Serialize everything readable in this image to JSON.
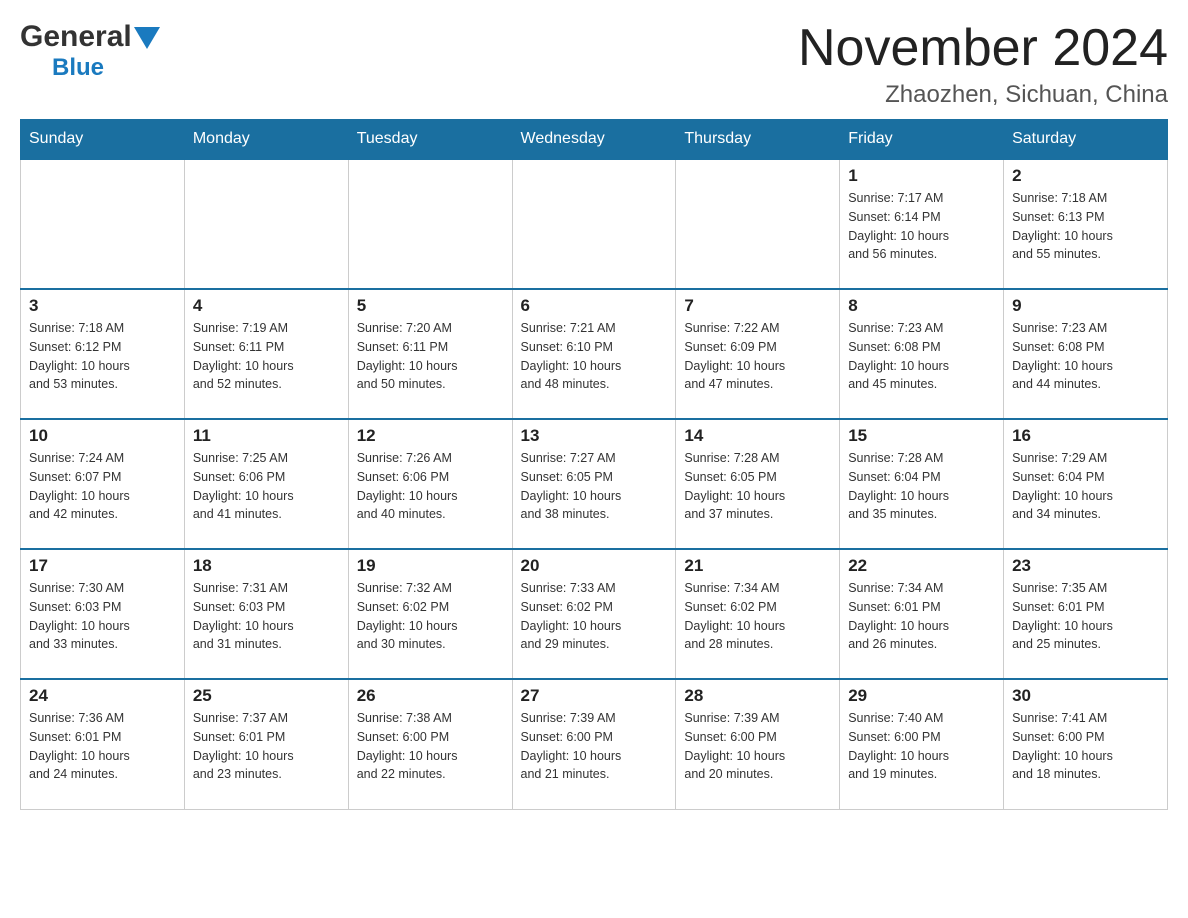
{
  "logo": {
    "general": "General",
    "blue": "Blue"
  },
  "header": {
    "month_year": "November 2024",
    "location": "Zhaozhen, Sichuan, China"
  },
  "days_of_week": [
    "Sunday",
    "Monday",
    "Tuesday",
    "Wednesday",
    "Thursday",
    "Friday",
    "Saturday"
  ],
  "weeks": [
    [
      {
        "day": "",
        "info": ""
      },
      {
        "day": "",
        "info": ""
      },
      {
        "day": "",
        "info": ""
      },
      {
        "day": "",
        "info": ""
      },
      {
        "day": "",
        "info": ""
      },
      {
        "day": "1",
        "info": "Sunrise: 7:17 AM\nSunset: 6:14 PM\nDaylight: 10 hours\nand 56 minutes."
      },
      {
        "day": "2",
        "info": "Sunrise: 7:18 AM\nSunset: 6:13 PM\nDaylight: 10 hours\nand 55 minutes."
      }
    ],
    [
      {
        "day": "3",
        "info": "Sunrise: 7:18 AM\nSunset: 6:12 PM\nDaylight: 10 hours\nand 53 minutes."
      },
      {
        "day": "4",
        "info": "Sunrise: 7:19 AM\nSunset: 6:11 PM\nDaylight: 10 hours\nand 52 minutes."
      },
      {
        "day": "5",
        "info": "Sunrise: 7:20 AM\nSunset: 6:11 PM\nDaylight: 10 hours\nand 50 minutes."
      },
      {
        "day": "6",
        "info": "Sunrise: 7:21 AM\nSunset: 6:10 PM\nDaylight: 10 hours\nand 48 minutes."
      },
      {
        "day": "7",
        "info": "Sunrise: 7:22 AM\nSunset: 6:09 PM\nDaylight: 10 hours\nand 47 minutes."
      },
      {
        "day": "8",
        "info": "Sunrise: 7:23 AM\nSunset: 6:08 PM\nDaylight: 10 hours\nand 45 minutes."
      },
      {
        "day": "9",
        "info": "Sunrise: 7:23 AM\nSunset: 6:08 PM\nDaylight: 10 hours\nand 44 minutes."
      }
    ],
    [
      {
        "day": "10",
        "info": "Sunrise: 7:24 AM\nSunset: 6:07 PM\nDaylight: 10 hours\nand 42 minutes."
      },
      {
        "day": "11",
        "info": "Sunrise: 7:25 AM\nSunset: 6:06 PM\nDaylight: 10 hours\nand 41 minutes."
      },
      {
        "day": "12",
        "info": "Sunrise: 7:26 AM\nSunset: 6:06 PM\nDaylight: 10 hours\nand 40 minutes."
      },
      {
        "day": "13",
        "info": "Sunrise: 7:27 AM\nSunset: 6:05 PM\nDaylight: 10 hours\nand 38 minutes."
      },
      {
        "day": "14",
        "info": "Sunrise: 7:28 AM\nSunset: 6:05 PM\nDaylight: 10 hours\nand 37 minutes."
      },
      {
        "day": "15",
        "info": "Sunrise: 7:28 AM\nSunset: 6:04 PM\nDaylight: 10 hours\nand 35 minutes."
      },
      {
        "day": "16",
        "info": "Sunrise: 7:29 AM\nSunset: 6:04 PM\nDaylight: 10 hours\nand 34 minutes."
      }
    ],
    [
      {
        "day": "17",
        "info": "Sunrise: 7:30 AM\nSunset: 6:03 PM\nDaylight: 10 hours\nand 33 minutes."
      },
      {
        "day": "18",
        "info": "Sunrise: 7:31 AM\nSunset: 6:03 PM\nDaylight: 10 hours\nand 31 minutes."
      },
      {
        "day": "19",
        "info": "Sunrise: 7:32 AM\nSunset: 6:02 PM\nDaylight: 10 hours\nand 30 minutes."
      },
      {
        "day": "20",
        "info": "Sunrise: 7:33 AM\nSunset: 6:02 PM\nDaylight: 10 hours\nand 29 minutes."
      },
      {
        "day": "21",
        "info": "Sunrise: 7:34 AM\nSunset: 6:02 PM\nDaylight: 10 hours\nand 28 minutes."
      },
      {
        "day": "22",
        "info": "Sunrise: 7:34 AM\nSunset: 6:01 PM\nDaylight: 10 hours\nand 26 minutes."
      },
      {
        "day": "23",
        "info": "Sunrise: 7:35 AM\nSunset: 6:01 PM\nDaylight: 10 hours\nand 25 minutes."
      }
    ],
    [
      {
        "day": "24",
        "info": "Sunrise: 7:36 AM\nSunset: 6:01 PM\nDaylight: 10 hours\nand 24 minutes."
      },
      {
        "day": "25",
        "info": "Sunrise: 7:37 AM\nSunset: 6:01 PM\nDaylight: 10 hours\nand 23 minutes."
      },
      {
        "day": "26",
        "info": "Sunrise: 7:38 AM\nSunset: 6:00 PM\nDaylight: 10 hours\nand 22 minutes."
      },
      {
        "day": "27",
        "info": "Sunrise: 7:39 AM\nSunset: 6:00 PM\nDaylight: 10 hours\nand 21 minutes."
      },
      {
        "day": "28",
        "info": "Sunrise: 7:39 AM\nSunset: 6:00 PM\nDaylight: 10 hours\nand 20 minutes."
      },
      {
        "day": "29",
        "info": "Sunrise: 7:40 AM\nSunset: 6:00 PM\nDaylight: 10 hours\nand 19 minutes."
      },
      {
        "day": "30",
        "info": "Sunrise: 7:41 AM\nSunset: 6:00 PM\nDaylight: 10 hours\nand 18 minutes."
      }
    ]
  ]
}
